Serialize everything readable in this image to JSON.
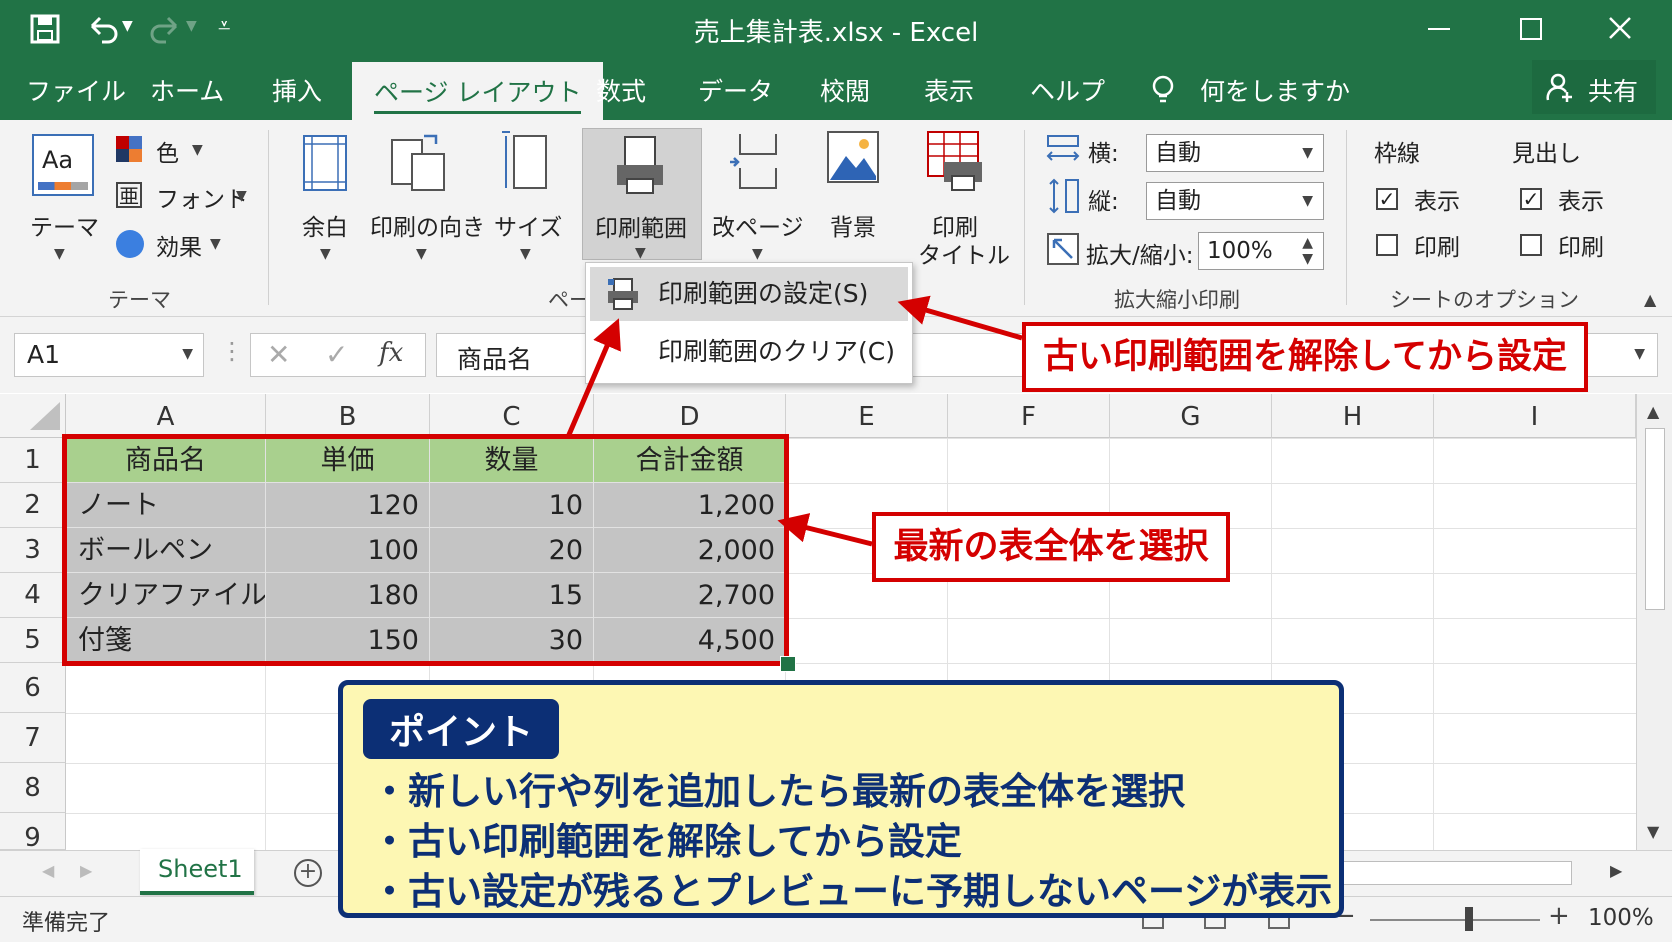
{
  "window": {
    "title": "売上集計表.xlsx  -  Excel"
  },
  "tabs": [
    "ファイル",
    "ホーム",
    "挿入",
    "ページ レイアウト",
    "数式",
    "データ",
    "校閲",
    "表示",
    "ヘルプ"
  ],
  "tell_me": "何をしますか",
  "share": "共有",
  "ribbon": {
    "themes": {
      "theme_label": "テーマ",
      "colors": "色",
      "fonts": "フォント",
      "effects": "効果",
      "group": "テーマ"
    },
    "page_setup": {
      "margins": "余白",
      "orientation": "印刷の向き",
      "size": "サイズ",
      "print_area": "印刷範囲",
      "breaks": "改ページ",
      "background": "背景",
      "print_titles_1": "印刷",
      "print_titles_2": "タイトル",
      "group": "ペー"
    },
    "scale": {
      "width_label": "横:",
      "width_value": "自動",
      "height_label": "縦:",
      "height_value": "自動",
      "scale_label": "拡大/縮小:",
      "scale_value": "100%",
      "group": "拡大縮小印刷"
    },
    "sheet_options": {
      "gridlines": "枠線",
      "headings": "見出し",
      "view": "表示",
      "print": "印刷",
      "group": "シートのオプション"
    }
  },
  "dropdown": {
    "set": "印刷範囲の設定(S)",
    "clear": "印刷範囲のクリア(C)"
  },
  "formula_bar": {
    "name_box": "A1",
    "formula": "商品名",
    "fx": "fx"
  },
  "columns": [
    "A",
    "B",
    "C",
    "D",
    "E",
    "F",
    "G",
    "H",
    "I"
  ],
  "rows": [
    "1",
    "2",
    "3",
    "4",
    "5",
    "6",
    "7",
    "8",
    "9"
  ],
  "table": {
    "header": [
      "商品名",
      "単価",
      "数量",
      "合計金額"
    ],
    "rows": [
      [
        "ノート",
        "120",
        "10",
        "1,200"
      ],
      [
        "ボールペン",
        "100",
        "20",
        "2,000"
      ],
      [
        "クリアファイル",
        "180",
        "15",
        "2,700"
      ],
      [
        "付箋",
        "150",
        "30",
        "4,500"
      ]
    ]
  },
  "callouts": {
    "top": "古い印刷範囲を解除してから設定",
    "middle": "最新の表全体を選択"
  },
  "point": {
    "badge": "ポイント",
    "items": [
      "・新しい行や列を追加したら最新の表全体を選択",
      "・古い印刷範囲を解除してから設定",
      "・古い設定が残るとプレビューに予期しないページが表示"
    ]
  },
  "sheet_tab": "Sheet1",
  "status": {
    "ready": "準備完了",
    "zoom": "100%"
  },
  "colors": {
    "excel_green": "#217346",
    "callout_red": "#d40000",
    "point_navy": "#0c2f75",
    "point_bg": "#fdf7b3",
    "header_fill": "#a9d08e",
    "selection_fill": "#c4c4c4"
  }
}
